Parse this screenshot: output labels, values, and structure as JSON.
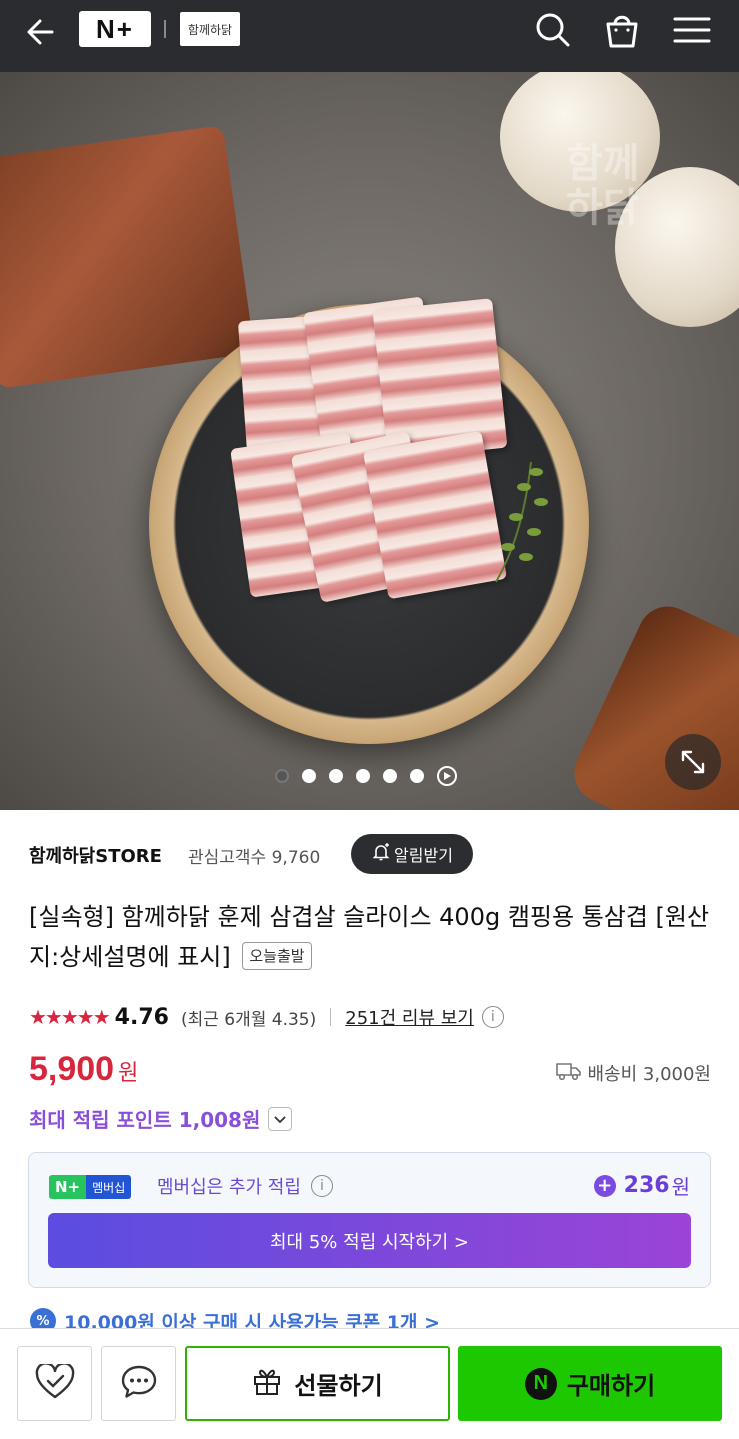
{
  "header": {
    "back_icon": "arrow-left-icon",
    "brand_logo": "N+",
    "store_logo": "함께하닭",
    "icons": [
      "search-icon",
      "shopping-bag-icon",
      "menu-icon"
    ]
  },
  "gallery": {
    "watermark": "함께\n하닭",
    "image_count": 6,
    "active_index": 0
  },
  "store": {
    "name": "함께하닭STORE",
    "followers_label": "관심고객수 9,760",
    "alarm_button": "알림받기"
  },
  "product": {
    "title": "[실속형] 함께하닭 훈제 삼겹살 슬라이스 400g 캠핑용 통삼겹 [원산지:상세설명에 표시]",
    "badge": "오늘출발",
    "stars": "★★★★★",
    "rating": "4.76",
    "recent_rating": "(최근 6개월 4.35)",
    "review_link": "251건 리뷰 보기",
    "price": "5,900",
    "price_unit": "원",
    "shipping": "배송비 3,000원",
    "max_points": "최대 적립 포인트 1,008원"
  },
  "membership": {
    "badge_logo": "N+",
    "badge_label": "멤버십",
    "text": "멤버십은 추가 적립",
    "extra_points": "236",
    "extra_points_unit": "원",
    "cta": "최대 5% 적립 시작하기 >"
  },
  "coupon": {
    "icon_label": "%",
    "text": "10,000원 이상 구매 시 사용가능 쿠폰 1개 >"
  },
  "bottom_bar": {
    "gift_label": "선물하기",
    "buy_label": "구매하기",
    "buy_icon_letter": "N"
  },
  "colors": {
    "price": "#d7263d",
    "points": "#8a4fd8",
    "buy": "#1ec800",
    "coupon": "#3a6fd6"
  }
}
